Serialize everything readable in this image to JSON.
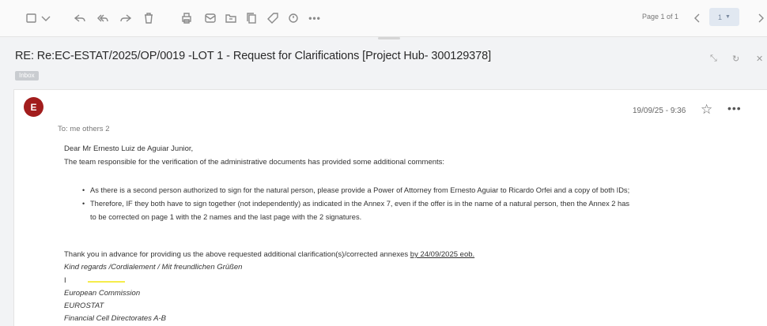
{
  "toolbar": {
    "icons": [
      "checkbox-icon",
      "chevron-down-icon",
      "reply-icon",
      "reply-all-icon",
      "forward-icon",
      "delete-icon",
      "print-icon",
      "mark-unread-icon",
      "move-to-folder-icon",
      "copy-icon",
      "tag-icon",
      "flag-icon",
      "more-icon"
    ],
    "page_label": "Page 1 of 1",
    "page_value": "1"
  },
  "message": {
    "subject": "RE: Re:EC-ESTAT/2025/OP/0019 -LOT 1 - Request for Clarifications [Project Hub- 300129378]",
    "folder_tag": "Inbox",
    "avatar_letter": "E",
    "date": "19/09/25 - 9:36",
    "to_line": "To: me others 2",
    "greeting": "Dear Mr Ernesto Luiz de Aguiar Junior,",
    "intro": "The team responsible for the verification of the administrative documents has provided some additional comments:",
    "bullets": [
      "As there is a second person authorized to sign for the natural person, please provide a Power of Attorney from Ernesto Aguiar to Ricardo Orfei and a copy of both IDs;",
      "Therefore, IF they both have to sign together (not independently) as indicated in the Annex 7, even if the offer is in the name of a natural person, then the Annex  2 has",
      "to be corrected on page 1 with the 2 names and the last page with the 2 signatures."
    ],
    "thanks_prefix": "Thank you in advance for providing us the above requested additional clarification(s)/corrected annexes ",
    "thanks_deadline": "by 24/09/2025 eob.",
    "regards": "Kind regards /Cordialement / Mit freundlichen Grüßen",
    "sig_initial": "I",
    "sig_org": "European Commission",
    "sig_dept": "EUROSTAT",
    "sig_unit": "Financial Cell Directorates A-B"
  },
  "colors": {
    "avatar": "#a21d1d",
    "highlight": "#f5ec4b",
    "pager": "#e1e8f1"
  }
}
